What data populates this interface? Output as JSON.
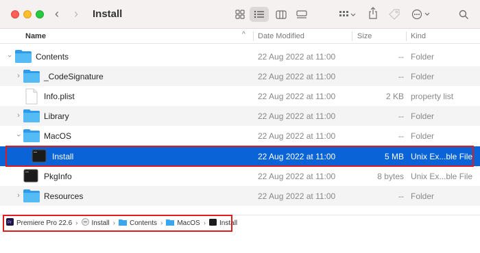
{
  "window": {
    "title": "Install"
  },
  "toolbar": {
    "back_glyph": "‹",
    "forward_glyph": "›",
    "icons": [
      "icon-view-icon",
      "list-view-icon",
      "column-view-icon",
      "gallery-view-icon",
      "group-icon",
      "share-icon",
      "tag-icon",
      "more-actions-icon",
      "search-icon"
    ]
  },
  "columns": {
    "name": "Name",
    "date": "Date Modified",
    "size": "Size",
    "kind": "Kind"
  },
  "rows": [
    {
      "name": "Contents",
      "date": "22 Aug 2022 at 11:00",
      "size": "--",
      "kind": "Folder"
    },
    {
      "name": "_CodeSignature",
      "date": "22 Aug 2022 at 11:00",
      "size": "--",
      "kind": "Folder"
    },
    {
      "name": "Info.plist",
      "date": "22 Aug 2022 at 11:00",
      "size": "2 KB",
      "kind": "property list"
    },
    {
      "name": "Library",
      "date": "22 Aug 2022 at 11:00",
      "size": "--",
      "kind": "Folder"
    },
    {
      "name": "MacOS",
      "date": "22 Aug 2022 at 11:00",
      "size": "--",
      "kind": "Folder"
    },
    {
      "name": "Install",
      "date": "22 Aug 2022 at 11:00",
      "size": "5 MB",
      "kind": "Unix Ex...ble File"
    },
    {
      "name": "PkgInfo",
      "date": "22 Aug 2022 at 11:00",
      "size": "8 bytes",
      "kind": "Unix Ex...ble File"
    },
    {
      "name": "Resources",
      "date": "22 Aug 2022 at 11:00",
      "size": "--",
      "kind": "Folder"
    }
  ],
  "pathbar": {
    "crumbs": [
      "Premiere Pro 22.6",
      "Install",
      "Contents",
      "MacOS",
      "Install"
    ],
    "separator": "›"
  },
  "colors": {
    "selection": "#0a64d8",
    "folder": "#3aa6f0",
    "highlight": "#e01b1b"
  }
}
